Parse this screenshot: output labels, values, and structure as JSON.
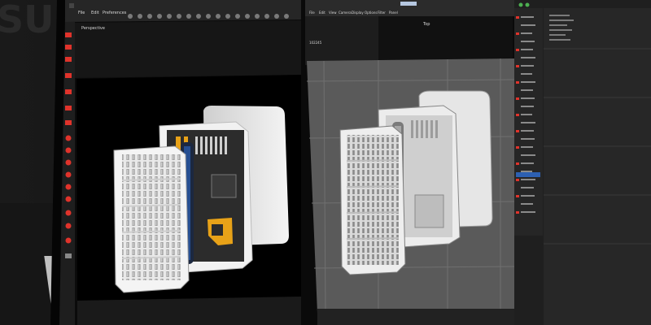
{
  "left_monitor": {
    "menu": [
      "File",
      "Edit",
      "Preferences"
    ],
    "viewport_label": "Perspective"
  },
  "right_monitor": {
    "viewport_label": "Top",
    "menu": [
      "File",
      "Edit",
      "View",
      "Camera",
      "Display",
      "Options",
      "Filter",
      "Panel"
    ],
    "panel_value": "102245"
  },
  "colors": {
    "render_background": "#0b0b0b",
    "viewport_background": "#5a5a5a",
    "ui_dark": "#2b2b2b",
    "accent_orange": "#e8a218",
    "accent_blue": "#2f6fd6",
    "status_red": "#e0332b"
  }
}
